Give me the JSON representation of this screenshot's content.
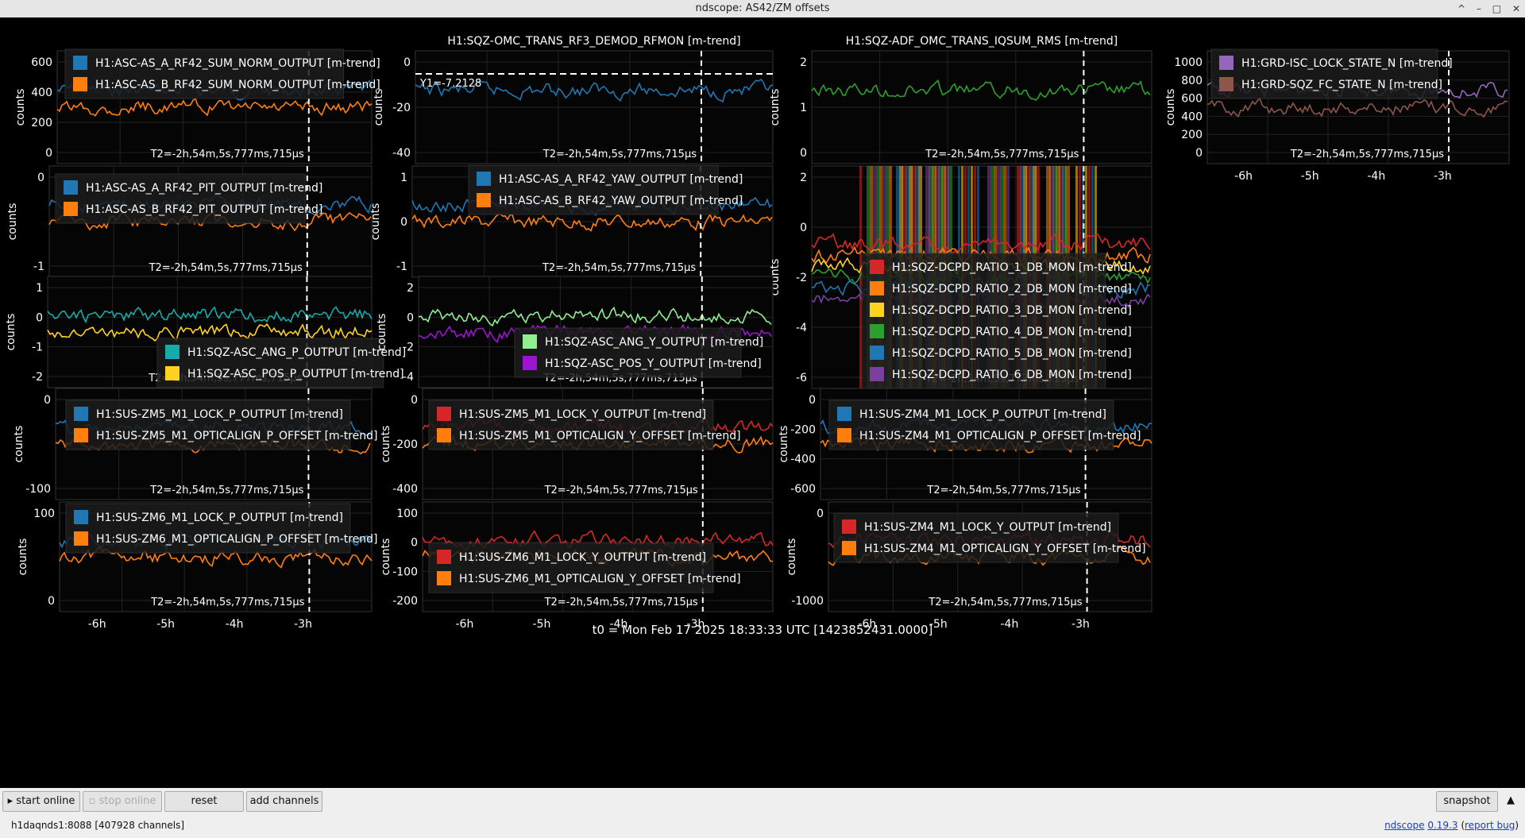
{
  "window": {
    "title": "ndscope: AS42/ZM offsets",
    "controls": [
      "^",
      "–",
      "□",
      "✕"
    ]
  },
  "colors": {
    "c1": "#1f77b4",
    "c2": "#ff7f0e",
    "c3": "#2ca02c",
    "c4": "#d62728",
    "c5": "#9467bd",
    "c6": "#8c564b",
    "teal": "#17aaaa",
    "yellow": "#ffd21f",
    "ltgreen": "#90ee90",
    "purple": "#9b14cf"
  },
  "cursor_label": "T2=-2h,54m,5s,777ms,715µs",
  "time_origin": "t0 = Mon Feb 17 2025 18:33:33 UTC [1423852431.0000]",
  "x_ticks": [
    "-6h",
    "-5h",
    "-4h",
    "-3h"
  ],
  "plots": [
    {
      "title": "",
      "ylabel": "counts",
      "yticks": [
        "600",
        "400",
        "200",
        "0"
      ],
      "legend": [
        {
          "label": "H1:ASC-AS_A_RF42_SUM_NORM_OUTPUT [m-trend]",
          "color": "#1f77b4"
        },
        {
          "label": "H1:ASC-AS_B_RF42_SUM_NORM_OUTPUT [m-trend]",
          "color": "#ff7f0e"
        }
      ]
    },
    {
      "title": "H1:SQZ-OMC_TRANS_RF3_DEMOD_RFMON [m-trend]",
      "ylabel": "counts",
      "yticks": [
        "0",
        "-20",
        "-40"
      ],
      "y1_label": "Y1=-7.2128",
      "legend": []
    },
    {
      "title": "H1:SQZ-ADF_OMC_TRANS_IQSUM_RMS [m-trend]",
      "ylabel": "counts",
      "yticks": [
        "2",
        "1",
        "0"
      ],
      "legend": []
    },
    {
      "title": "",
      "ylabel": "counts",
      "yticks": [
        "1000",
        "800",
        "600",
        "400",
        "200",
        "0"
      ],
      "legend": [
        {
          "label": "H1:GRD-ISC_LOCK_STATE_N [m-trend]",
          "color": "#9467bd"
        },
        {
          "label": "H1:GRD-SQZ_FC_STATE_N [m-trend]",
          "color": "#8c564b"
        }
      ]
    },
    {
      "title": "",
      "ylabel": "counts",
      "yticks": [
        "0",
        "-1"
      ],
      "legend": [
        {
          "label": "H1:ASC-AS_A_RF42_PIT_OUTPUT [m-trend]",
          "color": "#1f77b4"
        },
        {
          "label": "H1:ASC-AS_B_RF42_PIT_OUTPUT [m-trend]",
          "color": "#ff7f0e"
        }
      ]
    },
    {
      "title": "",
      "ylabel": "counts",
      "yticks": [
        "1",
        "0",
        "-1"
      ],
      "legend": [
        {
          "label": "H1:ASC-AS_A_RF42_YAW_OUTPUT [m-trend]",
          "color": "#1f77b4"
        },
        {
          "label": "H1:ASC-AS_B_RF42_YAW_OUTPUT [m-trend]",
          "color": "#ff7f0e"
        }
      ]
    },
    {
      "title": "",
      "ylabel": "counts",
      "yticks": [
        "2",
        "0",
        "-2",
        "-4",
        "-6"
      ],
      "legend": [
        {
          "label": "H1:SQZ-DCPD_RATIO_1_DB_MON [m-trend]",
          "color": "#d62728"
        },
        {
          "label": "H1:SQZ-DCPD_RATIO_2_DB_MON [m-trend]",
          "color": "#ff7f0e"
        },
        {
          "label": "H1:SQZ-DCPD_RATIO_3_DB_MON [m-trend]",
          "color": "#ffd21f"
        },
        {
          "label": "H1:SQZ-DCPD_RATIO_4_DB_MON [m-trend]",
          "color": "#2ca02c"
        },
        {
          "label": "H1:SQZ-DCPD_RATIO_5_DB_MON [m-trend]",
          "color": "#1f77b4"
        },
        {
          "label": "H1:SQZ-DCPD_RATIO_6_DB_MON [m-trend]",
          "color": "#7b3f9e"
        }
      ]
    },
    {
      "title": "",
      "ylabel": "counts",
      "yticks": [
        "1",
        "0",
        "-1",
        "-2"
      ],
      "legend": [
        {
          "label": "H1:SQZ-ASC_ANG_P_OUTPUT [m-trend]",
          "color": "#17aaaa"
        },
        {
          "label": "H1:SQZ-ASC_POS_P_OUTPUT [m-trend]",
          "color": "#ffd21f"
        }
      ]
    },
    {
      "title": "",
      "ylabel": "counts",
      "yticks": [
        "2",
        "0",
        "-2",
        "-4"
      ],
      "legend": [
        {
          "label": "H1:SQZ-ASC_ANG_Y_OUTPUT [m-trend]",
          "color": "#90ee90"
        },
        {
          "label": "H1:SQZ-ASC_POS_Y_OUTPUT [m-trend]",
          "color": "#9b14cf"
        }
      ]
    },
    {
      "title": "",
      "ylabel": "counts",
      "yticks": [
        "0",
        "-100"
      ],
      "legend": [
        {
          "label": "H1:SUS-ZM5_M1_LOCK_P_OUTPUT [m-trend]",
          "color": "#1f77b4"
        },
        {
          "label": "H1:SUS-ZM5_M1_OPTICALIGN_P_OFFSET [m-trend]",
          "color": "#ff7f0e"
        }
      ]
    },
    {
      "title": "",
      "ylabel": "counts",
      "yticks": [
        "0",
        "-200",
        "-400"
      ],
      "legend": [
        {
          "label": "H1:SUS-ZM5_M1_LOCK_Y_OUTPUT [m-trend]",
          "color": "#d62728"
        },
        {
          "label": "H1:SUS-ZM5_M1_OPTICALIGN_Y_OFFSET [m-trend]",
          "color": "#ff7f0e"
        }
      ]
    },
    {
      "title": "",
      "ylabel": "counts",
      "yticks": [
        "0",
        "-200",
        "-400",
        "-600"
      ],
      "legend": [
        {
          "label": "H1:SUS-ZM4_M1_LOCK_P_OUTPUT [m-trend]",
          "color": "#1f77b4"
        },
        {
          "label": "H1:SUS-ZM4_M1_OPTICALIGN_P_OFFSET [m-trend]",
          "color": "#ff7f0e"
        }
      ]
    },
    {
      "title": "",
      "ylabel": "counts",
      "yticks": [
        "100",
        "0"
      ],
      "legend": [
        {
          "label": "H1:SUS-ZM6_M1_LOCK_P_OUTPUT [m-trend]",
          "color": "#1f77b4"
        },
        {
          "label": "H1:SUS-ZM6_M1_OPTICALIGN_P_OFFSET [m-trend]",
          "color": "#ff7f0e"
        }
      ]
    },
    {
      "title": "",
      "ylabel": "counts",
      "yticks": [
        "100",
        "0",
        "-100",
        "-200"
      ],
      "legend": [
        {
          "label": "H1:SUS-ZM6_M1_LOCK_Y_OUTPUT [m-trend]",
          "color": "#d62728"
        },
        {
          "label": "H1:SUS-ZM6_M1_OPTICALIGN_Y_OFFSET [m-trend]",
          "color": "#ff7f0e"
        }
      ]
    },
    {
      "title": "",
      "ylabel": "counts",
      "yticks": [
        "0",
        "-1000"
      ],
      "legend": [
        {
          "label": "H1:SUS-ZM4_M1_LOCK_Y_OUTPUT [m-trend]",
          "color": "#d62728"
        },
        {
          "label": "H1:SUS-ZM4_M1_OPTICALIGN_Y_OFFSET [m-trend]",
          "color": "#ff7f0e"
        }
      ]
    }
  ],
  "toolbar": {
    "start_online": "start online",
    "stop_online": "stop online",
    "reset": "reset",
    "add_channels": "add channels",
    "snapshot": "snapshot",
    "expand": "▲"
  },
  "status": {
    "server": "h1daqnds1:8088  [407928 channels]",
    "app_name": "ndscope",
    "version": "0.19.3",
    "report_bug": "report bug"
  }
}
